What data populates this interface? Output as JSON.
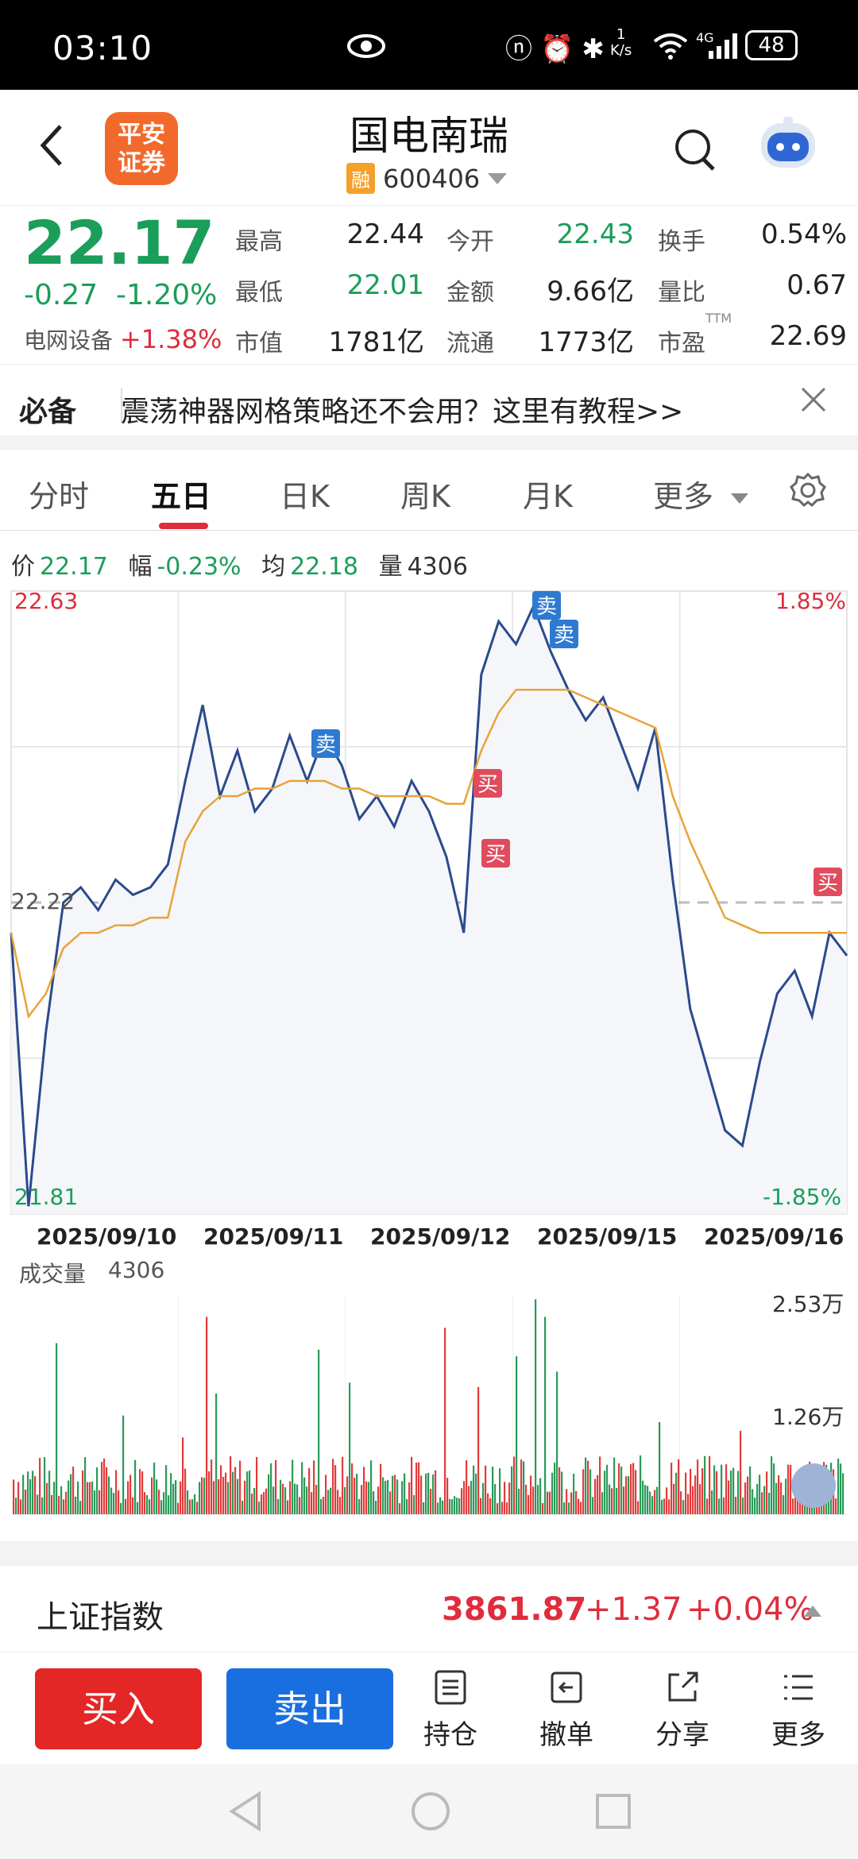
{
  "status": {
    "time": "03:10",
    "net_speed": "1",
    "net_unit": "K/s",
    "signal_label": "4G",
    "battery": "48"
  },
  "header": {
    "title": "国电南瑞",
    "margin_tag": "融",
    "code": "600406",
    "logo_text_1": "平安",
    "logo_text_2": "证券"
  },
  "quote": {
    "price": "22.17",
    "change": "-0.27",
    "change_pct": "-1.20%",
    "sector_name": "电网设备",
    "sector_change": "+1.38%",
    "fields": [
      {
        "label": "最高",
        "value": "22.44"
      },
      {
        "label": "今开",
        "value": "22.43"
      },
      {
        "label": "换手",
        "value": "0.54%"
      },
      {
        "label": "最低",
        "value": "22.01"
      },
      {
        "label": "金额",
        "value": "9.66亿"
      },
      {
        "label": "量比",
        "value": "0.67"
      },
      {
        "label": "市值",
        "value": "1781亿"
      },
      {
        "label": "流通",
        "value": "1773亿"
      },
      {
        "label": "市盈",
        "value": "22.69"
      }
    ],
    "ttm": "TTM"
  },
  "notice": {
    "tag": "必备",
    "text": "震荡神器网格策略还不会用？这里有教程>>"
  },
  "tabs": [
    "分时",
    "五日",
    "日K",
    "周K",
    "月K",
    "更多"
  ],
  "info_bar": {
    "price_label": "价",
    "price": "22.17",
    "range_label": "幅",
    "range": "-0.23%",
    "avg_label": "均",
    "avg": "22.18",
    "vol_label": "量",
    "vol": "4306"
  },
  "chart_labels": {
    "y_top": "22.63",
    "y_mid": "22.22",
    "y_bottom": "21.81",
    "pct_top": "1.85%",
    "pct_bottom": "-1.85%",
    "buy": "买",
    "sell": "卖"
  },
  "chart_data": {
    "type": "line",
    "x": [
      "2025/09/10",
      "2025/09/11",
      "2025/09/12",
      "2025/09/15",
      "2025/09/16"
    ],
    "ylim": [
      21.81,
      22.63
    ],
    "reference": 22.22,
    "series": [
      {
        "name": "",
        "color": "#2c4a8c",
        "values": [
          22.18,
          21.82,
          22.05,
          22.22,
          22.24,
          22.21,
          22.25,
          22.23,
          22.24,
          22.27,
          22.38,
          22.48,
          22.36,
          22.42,
          22.34,
          22.37,
          22.44,
          22.38,
          22.44,
          22.4,
          22.33,
          22.36,
          22.32,
          22.38,
          22.34,
          22.28,
          22.18,
          22.52,
          22.59,
          22.56,
          22.61,
          22.55,
          22.5,
          22.46,
          22.49,
          22.43,
          22.37,
          22.45,
          22.25,
          22.08,
          22.0,
          21.92,
          21.9,
          22.01,
          22.1,
          22.13,
          22.07,
          22.18,
          22.15
        ]
      },
      {
        "name": "",
        "color": "#e8a33a",
        "values": [
          22.18,
          22.07,
          22.1,
          22.16,
          22.18,
          22.18,
          22.19,
          22.19,
          22.2,
          22.2,
          22.3,
          22.34,
          22.36,
          22.36,
          22.37,
          22.37,
          22.38,
          22.38,
          22.38,
          22.37,
          22.37,
          22.36,
          22.36,
          22.36,
          22.36,
          22.35,
          22.35,
          22.42,
          22.47,
          22.5,
          22.5,
          22.5,
          22.5,
          22.49,
          22.48,
          22.47,
          22.46,
          22.45,
          22.36,
          22.3,
          22.25,
          22.2,
          22.19,
          22.18,
          22.18,
          22.18,
          22.18,
          22.18,
          22.18
        ]
      }
    ],
    "volume": {
      "title": "成交量",
      "value": "4306",
      "labels": [
        "2.53万",
        "1.26万"
      ],
      "max": 25300
    }
  },
  "index": {
    "name": "上证指数",
    "value": "3861.87",
    "change": "+1.37",
    "pct": "+0.04%"
  },
  "actions": {
    "buy": "买入",
    "sell": "卖出",
    "items": [
      "持仓",
      "撤单",
      "分享",
      "更多"
    ]
  }
}
